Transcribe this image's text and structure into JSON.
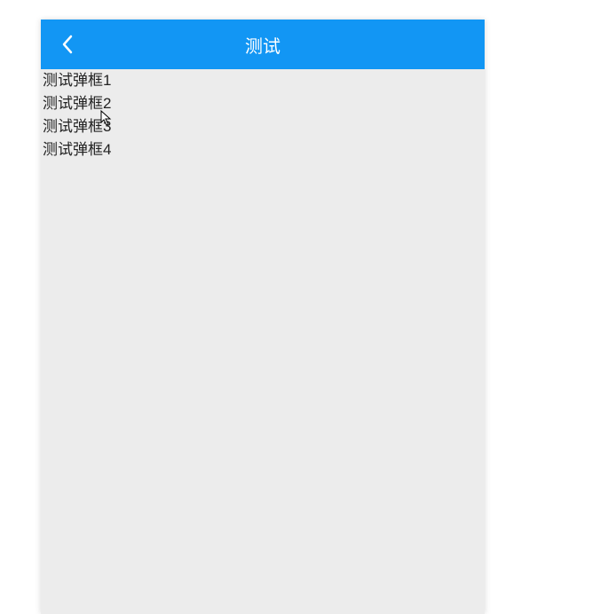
{
  "header": {
    "title": "测试"
  },
  "list": {
    "items": [
      {
        "label": "测试弹框1"
      },
      {
        "label": "测试弹框2"
      },
      {
        "label": "测试弹框3"
      },
      {
        "label": "测试弹框4"
      }
    ]
  }
}
